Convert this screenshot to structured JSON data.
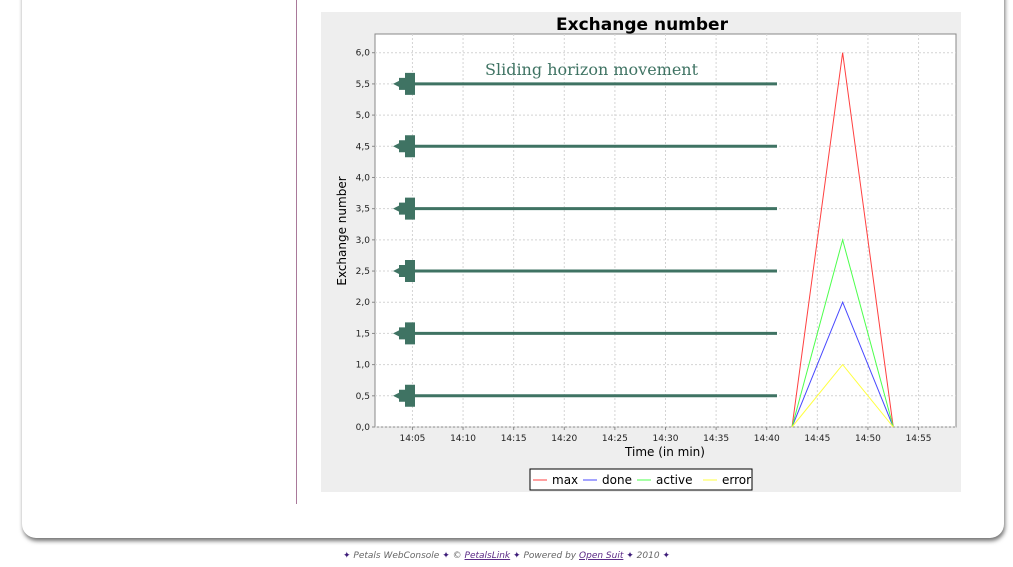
{
  "chart_data": {
    "type": "line",
    "title": "Exchange number",
    "xlabel": "Time (in min)",
    "ylabel": "Exchange number",
    "x_ticks": [
      "14:05",
      "14:10",
      "14:15",
      "14:20",
      "14:25",
      "14:30",
      "14:35",
      "14:40",
      "14:45",
      "14:50",
      "14:55"
    ],
    "y_ticks": [
      "0,0",
      "0,5",
      "1,0",
      "1,5",
      "2,0",
      "2,5",
      "3,0",
      "3,5",
      "4,0",
      "4,5",
      "5,0",
      "5,5",
      "6,0"
    ],
    "xlim_minutes_after_14_00": [
      1.3,
      58.7
    ],
    "ylim": [
      0,
      6.3
    ],
    "grid": true,
    "legend_position": "bottom",
    "x": [
      "14:42:30",
      "14:47:30",
      "14:52:30"
    ],
    "series": [
      {
        "name": "max",
        "color": "#ff4040",
        "values": [
          0,
          6,
          0
        ]
      },
      {
        "name": "done",
        "color": "#4848ff",
        "values": [
          0,
          2,
          0
        ]
      },
      {
        "name": "active",
        "color": "#4cff4c",
        "values": [
          0,
          3,
          0
        ]
      },
      {
        "name": "error",
        "color": "#ffff40",
        "values": [
          0,
          1,
          0
        ]
      }
    ],
    "annotation": {
      "text": "Sliding horizon movement",
      "arrow_color": "#3f7363",
      "arrow_levels": [
        5.5,
        4.5,
        3.5,
        2.5,
        1.5,
        0.5
      ]
    }
  },
  "footer": {
    "bullet": "✦",
    "console": "Petals WebConsole",
    "copyright": "©",
    "petalslink": "PetalsLink",
    "powered_by": "Powered by",
    "opensuit": "Open Suit",
    "year": "2010"
  }
}
